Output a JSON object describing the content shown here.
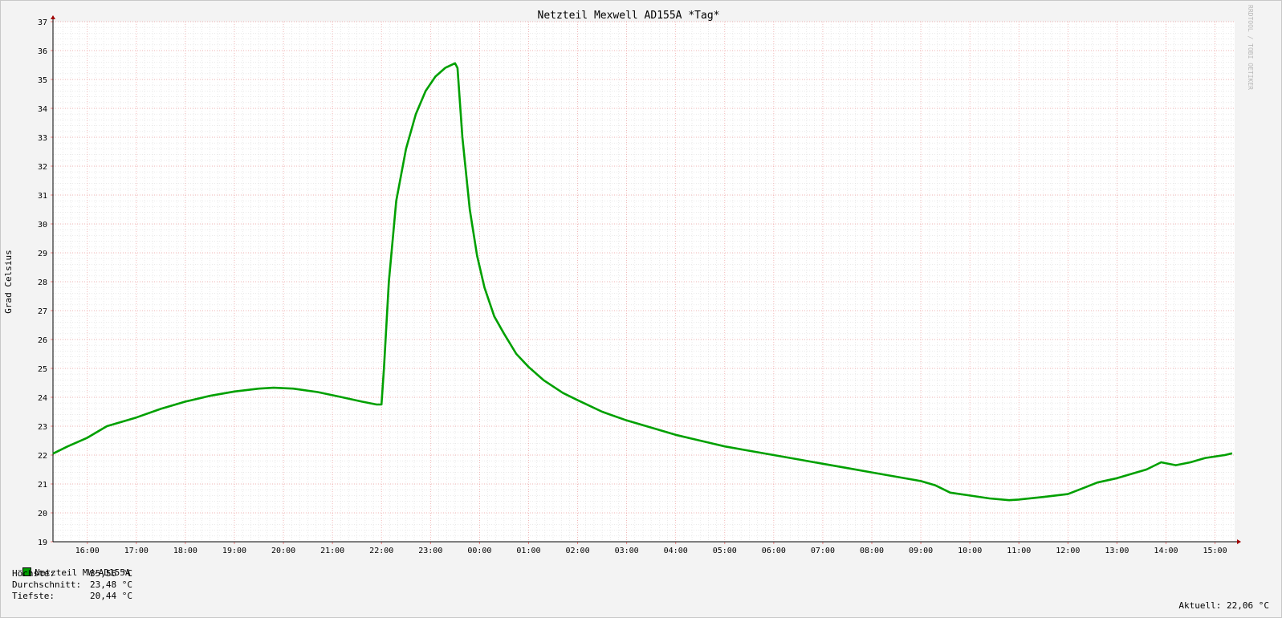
{
  "chart_data": {
    "type": "line",
    "title": "Netzteil Mexwell AD155A *Tag*",
    "ylabel": "Grad Celsius",
    "ylim": [
      19,
      37
    ],
    "yticks": [
      19,
      20,
      21,
      22,
      23,
      24,
      25,
      26,
      27,
      28,
      29,
      30,
      31,
      32,
      33,
      34,
      35,
      36,
      37
    ],
    "xlim": [
      15.3,
      39.4
    ],
    "xticks": [
      {
        "t": 16,
        "label": "16:00"
      },
      {
        "t": 17,
        "label": "17:00"
      },
      {
        "t": 18,
        "label": "18:00"
      },
      {
        "t": 19,
        "label": "19:00"
      },
      {
        "t": 20,
        "label": "20:00"
      },
      {
        "t": 21,
        "label": "21:00"
      },
      {
        "t": 22,
        "label": "22:00"
      },
      {
        "t": 23,
        "label": "23:00"
      },
      {
        "t": 24,
        "label": "00:00"
      },
      {
        "t": 25,
        "label": "01:00"
      },
      {
        "t": 26,
        "label": "02:00"
      },
      {
        "t": 27,
        "label": "03:00"
      },
      {
        "t": 28,
        "label": "04:00"
      },
      {
        "t": 29,
        "label": "05:00"
      },
      {
        "t": 30,
        "label": "06:00"
      },
      {
        "t": 31,
        "label": "07:00"
      },
      {
        "t": 32,
        "label": "08:00"
      },
      {
        "t": 33,
        "label": "09:00"
      },
      {
        "t": 34,
        "label": "10:00"
      },
      {
        "t": 35,
        "label": "11:00"
      },
      {
        "t": 36,
        "label": "12:00"
      },
      {
        "t": 37,
        "label": "13:00"
      },
      {
        "t": 38,
        "label": "14:00"
      },
      {
        "t": 39,
        "label": "15:00"
      }
    ],
    "grid": true,
    "series": [
      {
        "name": "Netzteil MW-AD155A",
        "color": "#00a000",
        "points": [
          [
            15.3,
            22.05
          ],
          [
            15.6,
            22.3
          ],
          [
            16.0,
            22.6
          ],
          [
            16.4,
            23.0
          ],
          [
            16.7,
            23.15
          ],
          [
            17.0,
            23.3
          ],
          [
            17.5,
            23.6
          ],
          [
            18.0,
            23.85
          ],
          [
            18.5,
            24.05
          ],
          [
            19.0,
            24.2
          ],
          [
            19.5,
            24.3
          ],
          [
            19.8,
            24.33
          ],
          [
            20.2,
            24.3
          ],
          [
            20.7,
            24.18
          ],
          [
            21.2,
            24.0
          ],
          [
            21.6,
            23.85
          ],
          [
            21.9,
            23.75
          ],
          [
            22.0,
            23.75
          ],
          [
            22.05,
            25.0
          ],
          [
            22.15,
            28.0
          ],
          [
            22.3,
            30.8
          ],
          [
            22.5,
            32.6
          ],
          [
            22.7,
            33.8
          ],
          [
            22.9,
            34.6
          ],
          [
            23.1,
            35.1
          ],
          [
            23.3,
            35.4
          ],
          [
            23.5,
            35.56
          ],
          [
            23.55,
            35.4
          ],
          [
            23.65,
            33.0
          ],
          [
            23.8,
            30.5
          ],
          [
            23.95,
            28.9
          ],
          [
            24.1,
            27.8
          ],
          [
            24.3,
            26.8
          ],
          [
            24.5,
            26.2
          ],
          [
            24.75,
            25.5
          ],
          [
            25.0,
            25.05
          ],
          [
            25.3,
            24.6
          ],
          [
            25.7,
            24.15
          ],
          [
            26.0,
            23.9
          ],
          [
            26.5,
            23.5
          ],
          [
            27.0,
            23.2
          ],
          [
            27.5,
            22.95
          ],
          [
            28.0,
            22.7
          ],
          [
            28.5,
            22.5
          ],
          [
            29.0,
            22.3
          ],
          [
            29.5,
            22.15
          ],
          [
            30.0,
            22.0
          ],
          [
            30.5,
            21.85
          ],
          [
            31.0,
            21.7
          ],
          [
            31.5,
            21.55
          ],
          [
            32.0,
            21.4
          ],
          [
            32.5,
            21.25
          ],
          [
            33.0,
            21.1
          ],
          [
            33.3,
            20.95
          ],
          [
            33.6,
            20.7
          ],
          [
            34.0,
            20.6
          ],
          [
            34.4,
            20.5
          ],
          [
            34.8,
            20.44
          ],
          [
            35.0,
            20.46
          ],
          [
            35.5,
            20.55
          ],
          [
            36.0,
            20.65
          ],
          [
            36.3,
            20.85
          ],
          [
            36.6,
            21.05
          ],
          [
            37.0,
            21.2
          ],
          [
            37.3,
            21.35
          ],
          [
            37.6,
            21.5
          ],
          [
            37.9,
            21.75
          ],
          [
            38.2,
            21.65
          ],
          [
            38.5,
            21.75
          ],
          [
            38.8,
            21.9
          ],
          [
            39.2,
            22.0
          ],
          [
            39.35,
            22.06
          ]
        ]
      }
    ],
    "watermark": "RRDTOOL / TOBI OETIKER"
  },
  "legend": {
    "series_name": "Netzteil MW-AD155A",
    "max_label": "Höchste:",
    "max_value": "35,56 °C",
    "avg_label": "Durchschnitt:",
    "avg_value": "23,48 °C",
    "min_label": "Tiefste:",
    "min_value": "20,44 °C",
    "current_label": "Aktuell:",
    "current_value": "22,06 °C"
  }
}
